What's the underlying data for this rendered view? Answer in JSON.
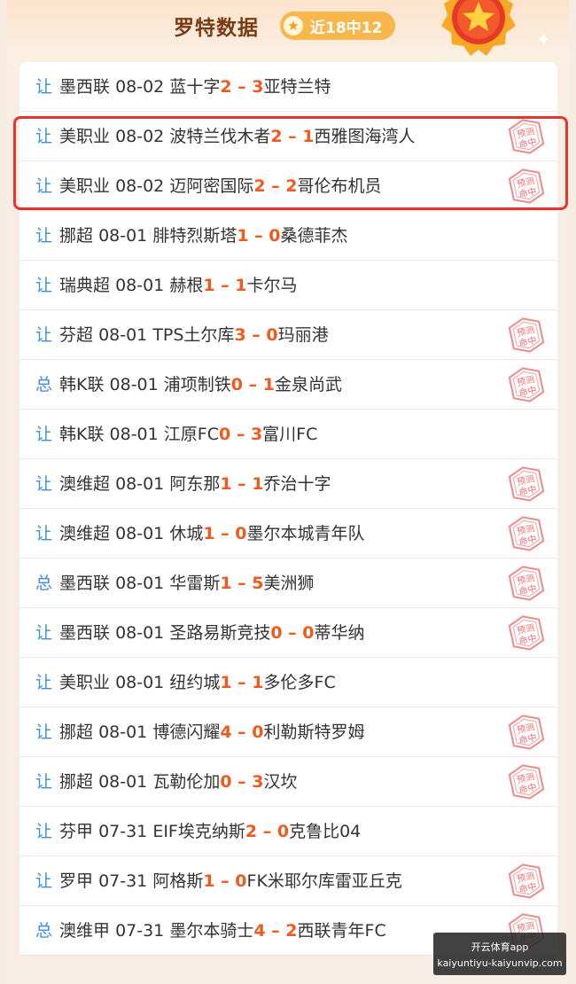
{
  "header": {
    "title": "罗特数据",
    "badge_label": "近18中12"
  },
  "stamp_label": "预测命中",
  "matches": [
    {
      "mark": "让",
      "league": "墨西联",
      "date": "08-02",
      "home": "蓝十字",
      "home_score": "2",
      "away_score": "3",
      "away": "亚特兰特",
      "hit": false
    },
    {
      "mark": "让",
      "league": "美职业",
      "date": "08-02",
      "home": "波特兰伐木者",
      "home_score": "2",
      "away_score": "1",
      "away": "西雅图海湾人",
      "hit": true
    },
    {
      "mark": "让",
      "league": "美职业",
      "date": "08-02",
      "home": "迈阿密国际",
      "home_score": "2",
      "away_score": "2",
      "away": "哥伦布机员",
      "hit": true
    },
    {
      "mark": "让",
      "league": "挪超",
      "date": "08-01",
      "home": "腓特烈斯塔",
      "home_score": "1",
      "away_score": "0",
      "away": "桑德菲杰",
      "hit": false
    },
    {
      "mark": "让",
      "league": "瑞典超",
      "date": "08-01",
      "home": "赫根",
      "home_score": "1",
      "away_score": "1",
      "away": "卡尔马",
      "hit": false
    },
    {
      "mark": "让",
      "league": "芬超",
      "date": "08-01",
      "home": "TPS土尔库",
      "home_score": "3",
      "away_score": "0",
      "away": "玛丽港",
      "hit": true
    },
    {
      "mark": "总",
      "league": "韩K联",
      "date": "08-01",
      "home": "浦项制铁",
      "home_score": "0",
      "away_score": "1",
      "away": "金泉尚武",
      "hit": true
    },
    {
      "mark": "让",
      "league": "韩K联",
      "date": "08-01",
      "home": "江原FC",
      "home_score": "0",
      "away_score": "3",
      "away": "富川FC",
      "hit": false
    },
    {
      "mark": "让",
      "league": "澳维超",
      "date": "08-01",
      "home": "阿东那",
      "home_score": "1",
      "away_score": "1",
      "away": "乔治十字",
      "hit": true
    },
    {
      "mark": "让",
      "league": "澳维超",
      "date": "08-01",
      "home": "休城",
      "home_score": "1",
      "away_score": "0",
      "away": "墨尔本城青年队",
      "hit": true
    },
    {
      "mark": "总",
      "league": "墨西联",
      "date": "08-01",
      "home": "华雷斯",
      "home_score": "1",
      "away_score": "5",
      "away": "美洲狮",
      "hit": true
    },
    {
      "mark": "让",
      "league": "墨西联",
      "date": "08-01",
      "home": "圣路易斯竞技",
      "home_score": "0",
      "away_score": "0",
      "away": "蒂华纳",
      "hit": true
    },
    {
      "mark": "让",
      "league": "美职业",
      "date": "08-01",
      "home": "纽约城",
      "home_score": "1",
      "away_score": "1",
      "away": "多伦多FC",
      "hit": false
    },
    {
      "mark": "让",
      "league": "挪超",
      "date": "08-01",
      "home": "博德闪耀",
      "home_score": "4",
      "away_score": "0",
      "away": "利勒斯特罗姆",
      "hit": true
    },
    {
      "mark": "让",
      "league": "挪超",
      "date": "08-01",
      "home": "瓦勒伦加",
      "home_score": "0",
      "away_score": "3",
      "away": "汉坎",
      "hit": true
    },
    {
      "mark": "让",
      "league": "芬甲",
      "date": "07-31",
      "home": "EIF埃克纳斯",
      "home_score": "2",
      "away_score": "0",
      "away": "克鲁比04",
      "hit": false
    },
    {
      "mark": "让",
      "league": "罗甲",
      "date": "07-31",
      "home": "阿格斯",
      "home_score": "1",
      "away_score": "0",
      "away": "FK米耶尔库雷亚丘克",
      "hit": true
    },
    {
      "mark": "总",
      "league": "澳维甲",
      "date": "07-31",
      "home": "墨尔本骑士",
      "home_score": "4",
      "away_score": "2",
      "away": "西联青年FC",
      "hit": true
    }
  ],
  "watermark": {
    "line1": "开云体育app",
    "line2": "kaiyuntiyu-kaiyunvip.com"
  },
  "colors": {
    "accent": "#f15a1c",
    "mark": "#3a8ee8",
    "highlight": "#e8322e",
    "badge": "#f8b74a"
  }
}
